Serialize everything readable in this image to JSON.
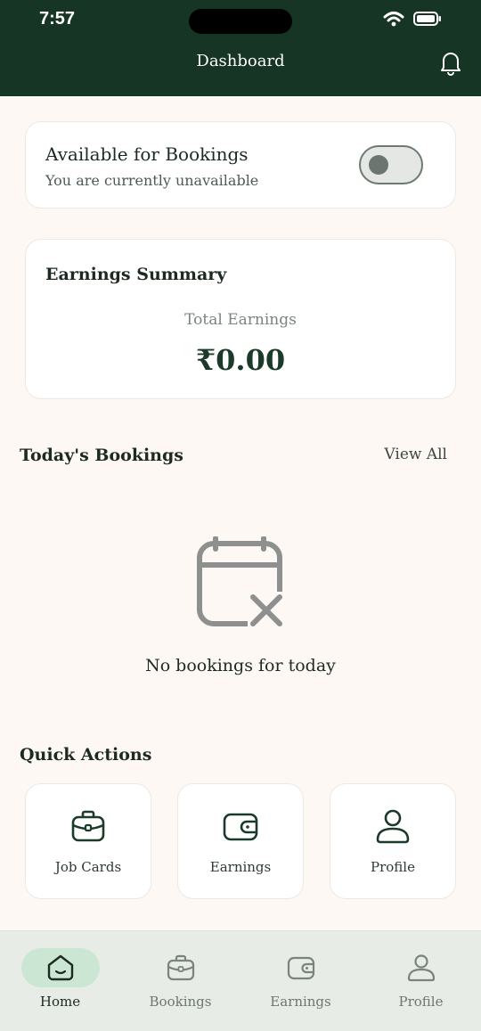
{
  "status_bar": {
    "time": "7:57"
  },
  "header": {
    "title": "Dashboard"
  },
  "availability": {
    "title": "Available for Bookings",
    "subtitle": "You are currently unavailable",
    "toggle_on": false
  },
  "earnings": {
    "title": "Earnings Summary",
    "label": "Total Earnings",
    "value": "₹0.00"
  },
  "today": {
    "title": "Today's Bookings",
    "view_all": "View All",
    "empty_text": "No bookings for today"
  },
  "quick_actions": {
    "title": "Quick Actions",
    "items": [
      {
        "label": "Job Cards",
        "icon": "briefcase-icon"
      },
      {
        "label": "Earnings",
        "icon": "wallet-icon"
      },
      {
        "label": "Profile",
        "icon": "user-icon"
      }
    ]
  },
  "nav": {
    "items": [
      {
        "label": "Home",
        "icon": "home-icon",
        "active": true
      },
      {
        "label": "Bookings",
        "icon": "briefcase-icon"
      },
      {
        "label": "Earnings",
        "icon": "wallet-icon"
      },
      {
        "label": "Profile",
        "icon": "user-icon"
      }
    ]
  },
  "colors": {
    "header_bg": "#163524",
    "page_bg": "#fdf8f4",
    "nav_bg": "#e8ece7",
    "active_pill": "#cce6d4",
    "accent": "#1b3a2a"
  }
}
